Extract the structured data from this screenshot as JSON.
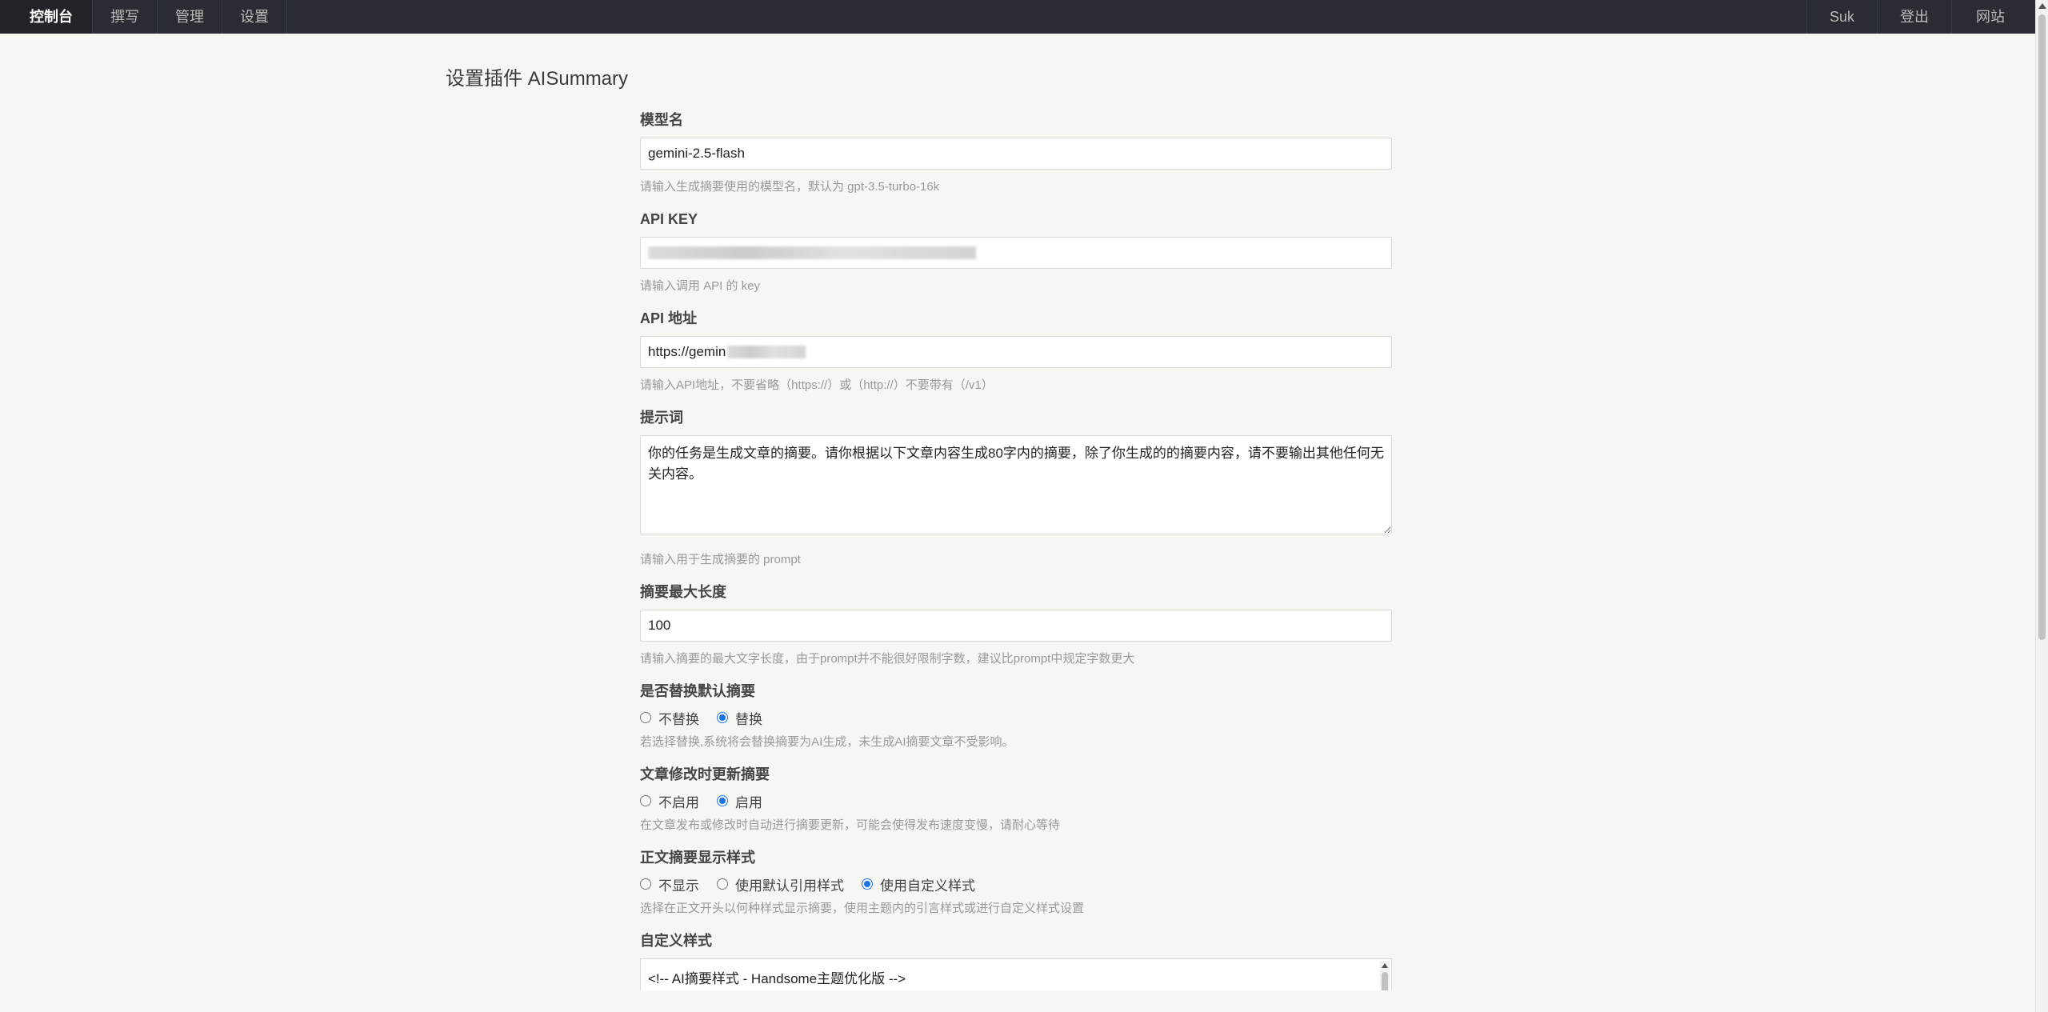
{
  "nav": {
    "left": [
      "控制台",
      "撰写",
      "管理",
      "设置"
    ],
    "right": [
      "Suk",
      "登出",
      "网站"
    ]
  },
  "page_title": "设置插件 AISummary",
  "fields": {
    "model": {
      "label": "模型名",
      "value": "gemini-2.5-flash",
      "desc": "请输入生成摘要使用的模型名，默认为 gpt-3.5-turbo-16k"
    },
    "api_key": {
      "label": "API KEY",
      "value": "",
      "desc": "请输入调用 API 的 key"
    },
    "api_url": {
      "label": "API 地址",
      "value": "https://gemin",
      "desc": "请输入API地址，不要省略（https://）或（http://）不要带有（/v1）"
    },
    "prompt": {
      "label": "提示词",
      "value": "你的任务是生成文章的摘要。请你根据以下文章内容生成80字内的摘要，除了你生成的的摘要内容，请不要输出其他任何无关内容。",
      "desc": "请输入用于生成摘要的 prompt"
    },
    "max_length": {
      "label": "摘要最大长度",
      "value": "100",
      "desc": "请输入摘要的最大文字长度，由于prompt并不能很好限制字数，建议比prompt中规定字数更大"
    },
    "replace_default": {
      "label": "是否替换默认摘要",
      "options": [
        "不替换",
        "替换"
      ],
      "selected": "替换",
      "desc": "若选择替换,系统将会替换摘要为AI生成，未生成AI摘要文章不受影响。"
    },
    "update_on_edit": {
      "label": "文章修改时更新摘要",
      "options": [
        "不启用",
        "启用"
      ],
      "selected": "启用",
      "desc": "在文章发布或修改时自动进行摘要更新，可能会使得发布速度变慢，请耐心等待"
    },
    "display_style": {
      "label": "正文摘要显示样式",
      "options": [
        "不显示",
        "使用默认引用样式",
        "使用自定义样式"
      ],
      "selected": "使用自定义样式",
      "desc": "选择在正文开头以何种样式显示摘要，使用主题内的引言样式或进行自定义样式设置"
    },
    "custom_style": {
      "label": "自定义样式",
      "first_line": "<!-- AI摘要样式 - Handsome主题优化版 -->"
    }
  },
  "colors": {
    "topbar": "#292d33",
    "page_bg": "#f6f6f3",
    "radio_checked": "#1a73e8"
  }
}
